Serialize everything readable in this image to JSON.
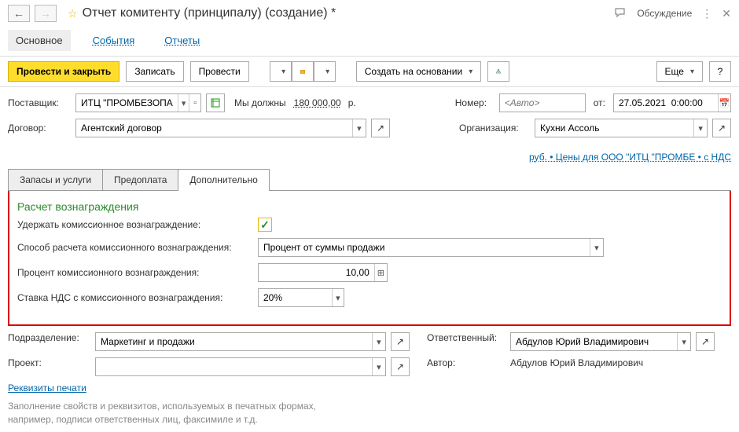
{
  "header": {
    "title": "Отчет комитенту (принципалу) (создание) *",
    "discuss": "Обсуждение"
  },
  "navbar": {
    "main": "Основное",
    "events": "События",
    "reports": "Отчеты"
  },
  "toolbar": {
    "post_close": "Провести и закрыть",
    "save": "Записать",
    "post": "Провести",
    "create_based": "Создать на основании",
    "more": "Еще",
    "help": "?"
  },
  "form": {
    "supplier_lbl": "Поставщик:",
    "supplier_val": "ИТЦ \"ПРОМБЕЗОПАСНОСТЬ\"",
    "debt_prefix": "Мы должны",
    "debt_amount": "180 000,00",
    "debt_cur": "р.",
    "number_lbl": "Номер:",
    "number_placeholder": "<Авто>",
    "date_lbl": "от:",
    "date_val": "27.05.2021  0:00:00",
    "contract_lbl": "Договор:",
    "contract_val": "Агентский договор",
    "org_lbl": "Организация:",
    "org_val": "Кухни Ассоль",
    "prices_link": "руб. • Цены для ООО \"ИТЦ \"ПРОМБЕ • с НДС"
  },
  "tabs": {
    "stock": "Запасы и услуги",
    "prepay": "Предоплата",
    "extra": "Дополнительно"
  },
  "comm": {
    "section": "Расчет вознаграждения",
    "retain_lbl": "Удержать комиссионное вознаграждение:",
    "method_lbl": "Способ расчета комиссионного вознаграждения:",
    "method_val": "Процент от суммы продажи",
    "pct_lbl": "Процент комиссионного вознаграждения:",
    "pct_val": "10,00",
    "vat_lbl": "Ставка НДС с комиссионного вознаграждения:",
    "vat_val": "20%"
  },
  "below": {
    "dept_lbl": "Подразделение:",
    "dept_val": "Маркетинг и продажи",
    "resp_lbl": "Ответственный:",
    "resp_val": "Абдулов Юрий Владимирович",
    "project_lbl": "Проект:",
    "author_lbl": "Автор:",
    "author_val": "Абдулов Юрий Владимирович",
    "print_req": "Реквизиты печати",
    "hint": "Заполнение свойств и реквизитов, используемых в печатных формах, например, подписи ответственных лиц, факсимиле и т.д."
  }
}
